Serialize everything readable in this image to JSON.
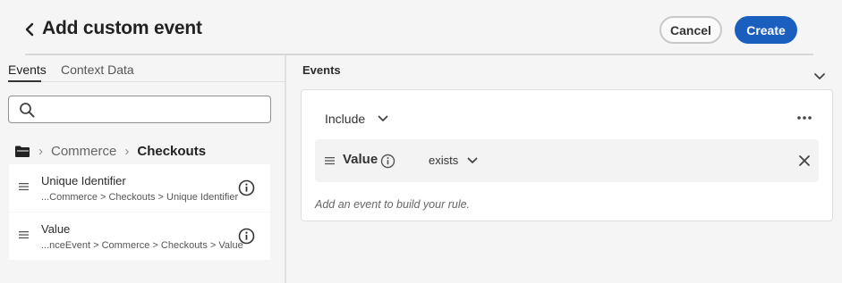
{
  "header": {
    "title": "Add custom event",
    "cancel_label": "Cancel",
    "create_label": "Create"
  },
  "left_panel": {
    "tabs": [
      {
        "label": "Events",
        "active": true
      },
      {
        "label": "Context Data",
        "active": false
      }
    ],
    "search": {
      "value": "",
      "placeholder": ""
    },
    "breadcrumb": {
      "icon": "folder-icon",
      "items": [
        "Commerce",
        "Checkouts"
      ]
    },
    "items": [
      {
        "title": "Unique Identifier",
        "path": "...Commerce > Checkouts > Unique Identifier"
      },
      {
        "title": "Value",
        "path": "...nceEvent > Commerce > Checkouts > Value"
      }
    ]
  },
  "right_panel": {
    "heading": "Events",
    "include_label": "Include",
    "rule": {
      "field": "Value",
      "operator": "exists"
    },
    "hint": "Add an event to build your rule."
  },
  "colors": {
    "accent": "#1b5fbe",
    "background": "#f5f5f5",
    "card": "#ffffff"
  }
}
